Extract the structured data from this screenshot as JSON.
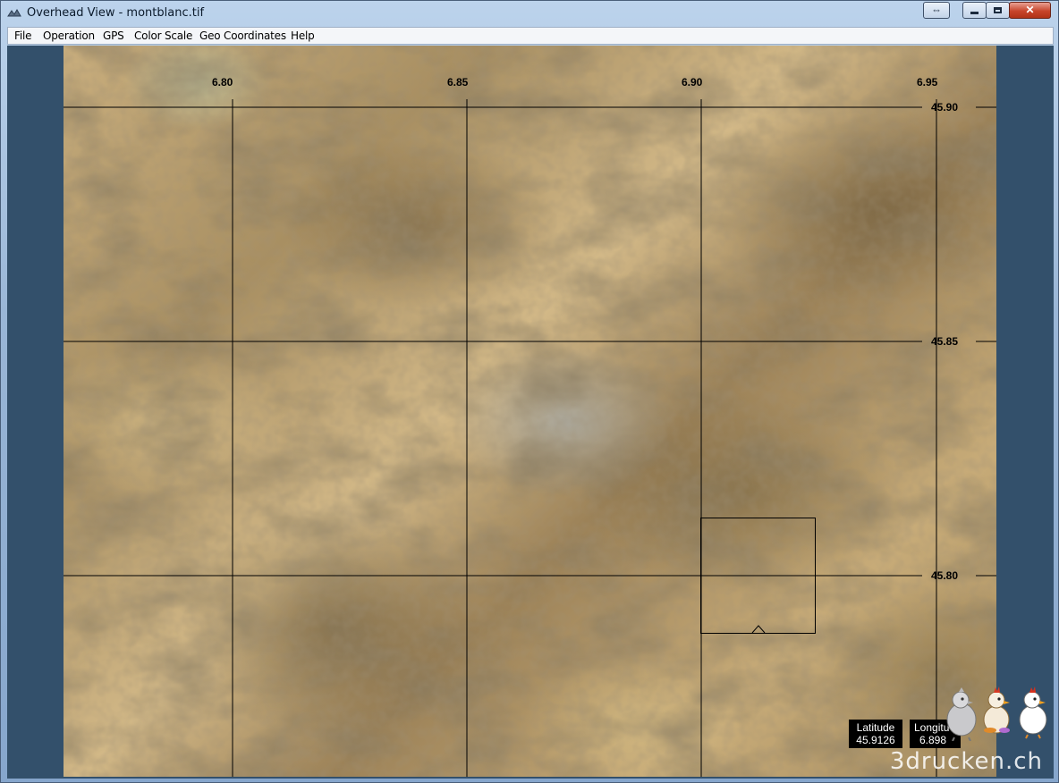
{
  "window": {
    "title": "Overhead View - montblanc.tif",
    "buttons": {
      "extra": "⇔",
      "minimize": "▬",
      "maximize": "☐",
      "close": "✕"
    }
  },
  "menu": {
    "items": [
      "File",
      "Operation",
      "GPS",
      "Color Scale",
      "Geo Coordinates",
      "Help"
    ]
  },
  "map": {
    "longitude_labels": [
      "6.80",
      "6.85",
      "6.90",
      "6.95"
    ],
    "latitude_labels": [
      "45.90",
      "45.85",
      "45.80"
    ]
  },
  "readout": {
    "latitude_label": "Latitude",
    "latitude_value": "45.9126",
    "longitude_label": "Longitu",
    "longitude_value": "6.898"
  },
  "watermark": "3drucken.ch",
  "colors": {
    "client_background": "#33506b",
    "grid_line": "#000000"
  }
}
